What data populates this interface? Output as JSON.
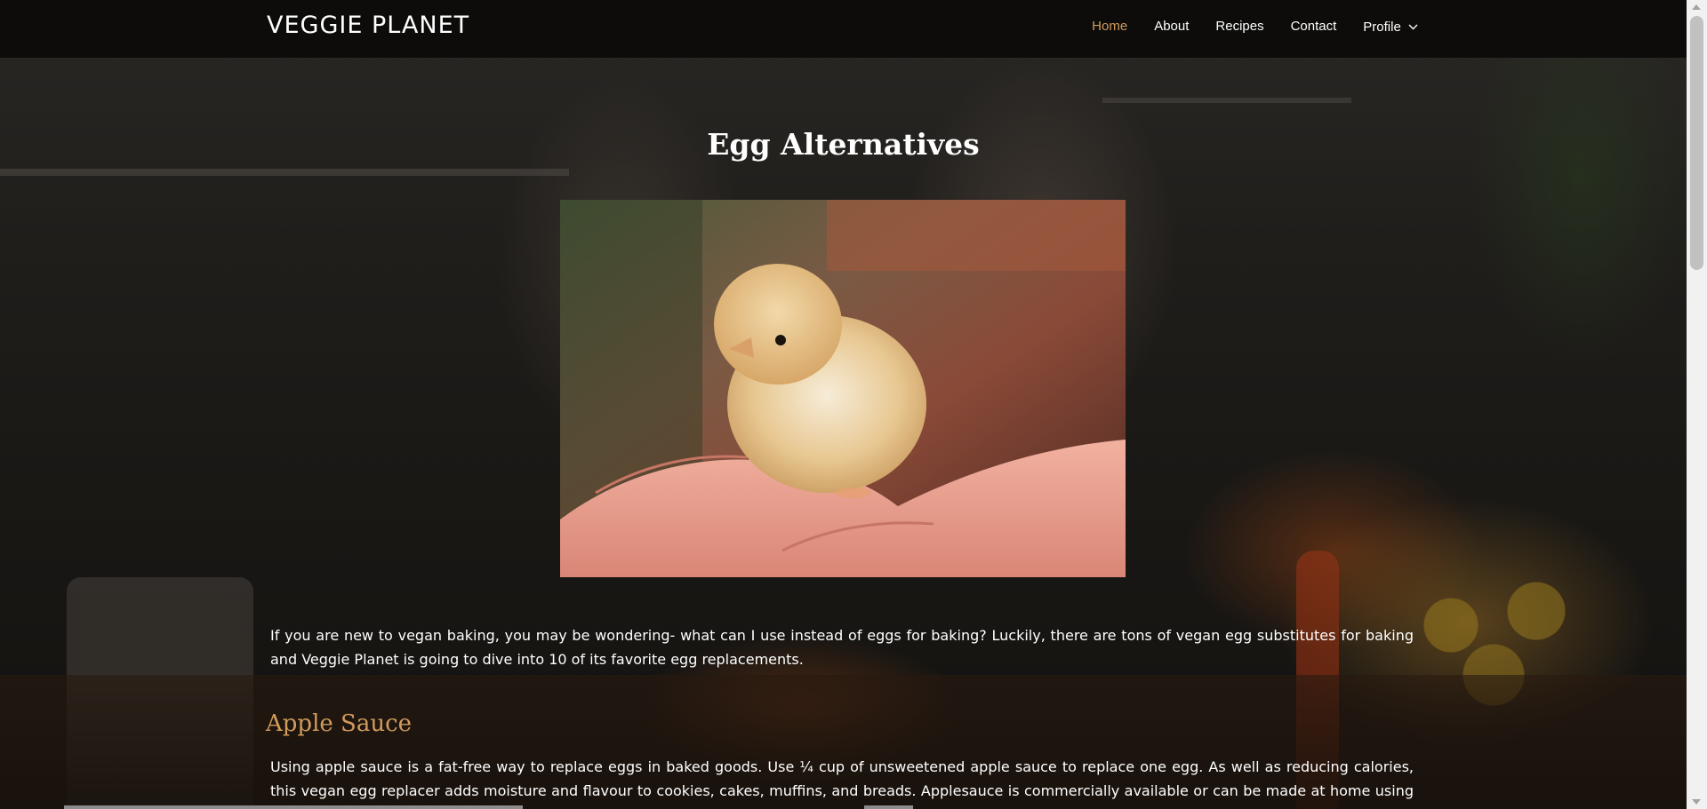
{
  "navbar": {
    "brand": "VEGGIE PLANET",
    "items": [
      {
        "label": "Home",
        "active": true
      },
      {
        "label": "About",
        "active": false
      },
      {
        "label": "Recipes",
        "active": false
      },
      {
        "label": "Contact",
        "active": false
      },
      {
        "label": "Profile",
        "active": false,
        "has_dropdown": true
      }
    ]
  },
  "main": {
    "title": "Egg Alternatives",
    "hero_image": {
      "icon": "chick-in-hands-photo"
    },
    "intro": "If you are new to vegan baking, you may be wondering- what can I use instead of eggs for baking? Luckily, there are tons of vegan egg substitutes for baking and Veggie Planet is going to dive into 10 of its favorite egg replacements.",
    "sections": [
      {
        "heading": "Apple Sauce",
        "text": "Using apple sauce is a fat-free way to replace eggs in baked goods. Use ¼ cup of unsweetened apple sauce to replace one egg. As well as reducing calories, this vegan egg replacer adds moisture and flavour to cookies, cakes, muffins, and breads. Applesauce is commercially available or can be made at home using fresh apples."
      }
    ]
  },
  "colors": {
    "accent": "#d19b5c",
    "navbar_bg": "#0d0c0b",
    "text": "#ffffff"
  }
}
